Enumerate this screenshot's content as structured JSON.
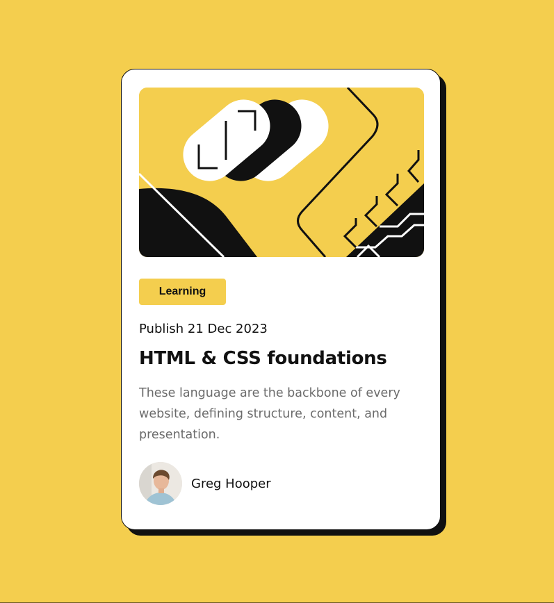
{
  "card": {
    "category": "Learning",
    "published": "Publish 21 Dec 2023",
    "title": "HTML & CSS foundations",
    "description": "These language are the backbone of every website, defining structure, content, and presentation.",
    "author": {
      "name": "Greg Hooper"
    }
  },
  "colors": {
    "background": "#F4CE4E",
    "accent": "#F4CE4E",
    "text": "#111111",
    "muted_text": "#6b6b6b",
    "card": "#ffffff"
  },
  "icons": {
    "hero_illustration": "abstract-geometric-illustration",
    "avatar": "author-avatar-photo"
  }
}
